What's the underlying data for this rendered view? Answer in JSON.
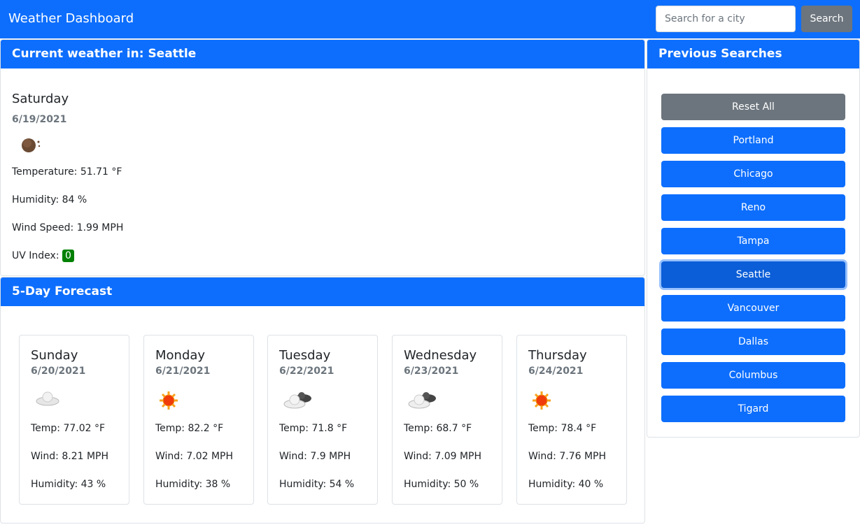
{
  "app": {
    "title": "Weather Dashboard",
    "search_placeholder": "Search for a city",
    "search_button": "Search"
  },
  "current": {
    "header": "Current weather in: Seattle",
    "day": "Saturday",
    "date": "6/19/2021",
    "icon": "night-moon-icon",
    "temperature": "Temperature: 51.71 °F",
    "humidity": "Humidity: 84 %",
    "wind": "Wind Speed: 1.99 MPH",
    "uv_label": "UV Index:",
    "uv_value": "0",
    "uv_color": "#008000"
  },
  "forecast": {
    "header": "5-Day Forecast",
    "days": [
      {
        "day": "Sunday",
        "date": "6/20/2021",
        "icon": "cloud-icon",
        "temp": "Temp: 77.02 °F",
        "wind": "Wind: 8.21 MPH",
        "humidity": "Humidity: 43 %"
      },
      {
        "day": "Monday",
        "date": "6/21/2021",
        "icon": "sun-icon",
        "temp": "Temp: 82.2 °F",
        "wind": "Wind: 7.02 MPH",
        "humidity": "Humidity: 38 %"
      },
      {
        "day": "Tuesday",
        "date": "6/22/2021",
        "icon": "broken-clouds-icon",
        "temp": "Temp: 71.8 °F",
        "wind": "Wind: 7.9 MPH",
        "humidity": "Humidity: 54 %"
      },
      {
        "day": "Wednesday",
        "date": "6/23/2021",
        "icon": "broken-clouds-icon",
        "temp": "Temp: 68.7 °F",
        "wind": "Wind: 7.09 MPH",
        "humidity": "Humidity: 50 %"
      },
      {
        "day": "Thursday",
        "date": "6/24/2021",
        "icon": "sun-icon",
        "temp": "Temp: 78.4 °F",
        "wind": "Wind: 7.76 MPH",
        "humidity": "Humidity: 40 %"
      }
    ]
  },
  "previous": {
    "header": "Previous Searches",
    "reset": "Reset All",
    "cities": [
      "Portland",
      "Chicago",
      "Reno",
      "Tampa",
      "Seattle",
      "Vancouver",
      "Dallas",
      "Columbus",
      "Tigard"
    ],
    "active": "Seattle"
  },
  "colors": {
    "primary": "#0d6efd",
    "secondary": "#6c757d",
    "active": "#0b5ed7"
  }
}
